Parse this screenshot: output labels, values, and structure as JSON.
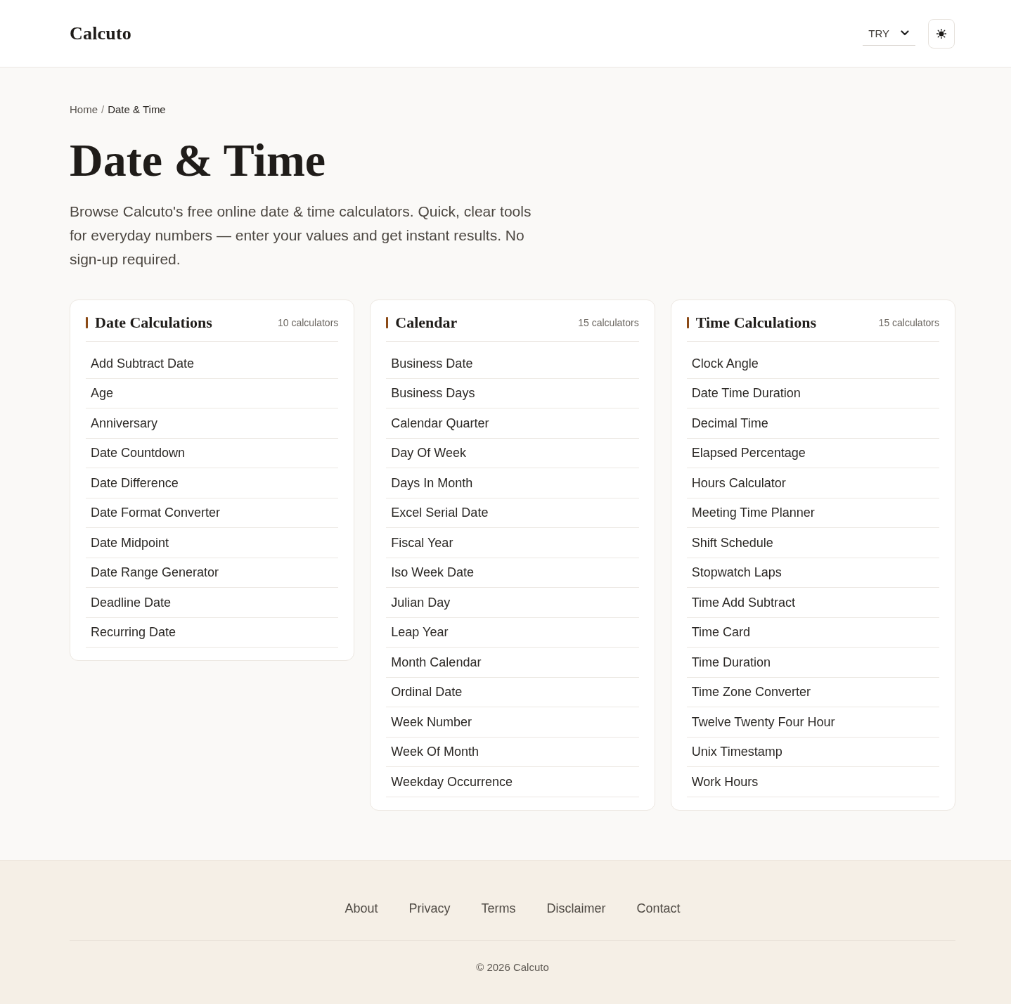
{
  "header": {
    "logo": "Calcuto",
    "currency": {
      "value": "TRY"
    }
  },
  "breadcrumb": {
    "separator": "/",
    "items": [
      {
        "label": "Home",
        "current": false
      },
      {
        "label": "Date & Time",
        "current": true
      }
    ]
  },
  "page": {
    "title": "Date & Time",
    "description": "Browse Calcuto's free online date & time calculators. Quick, clear tools for everyday numbers — enter your values and get instant results. No sign-up required."
  },
  "categories": [
    {
      "title": "Date Calculations",
      "count": "10 calculators",
      "items": [
        "Add Subtract Date",
        "Age",
        "Anniversary",
        "Date Countdown",
        "Date Difference",
        "Date Format Converter",
        "Date Midpoint",
        "Date Range Generator",
        "Deadline Date",
        "Recurring Date"
      ]
    },
    {
      "title": "Calendar",
      "count": "15 calculators",
      "items": [
        "Business Date",
        "Business Days",
        "Calendar Quarter",
        "Day Of Week",
        "Days In Month",
        "Excel Serial Date",
        "Fiscal Year",
        "Iso Week Date",
        "Julian Day",
        "Leap Year",
        "Month Calendar",
        "Ordinal Date",
        "Week Number",
        "Week Of Month",
        "Weekday Occurrence"
      ]
    },
    {
      "title": "Time Calculations",
      "count": "15 calculators",
      "items": [
        "Clock Angle",
        "Date Time Duration",
        "Decimal Time",
        "Elapsed Percentage",
        "Hours Calculator",
        "Meeting Time Planner",
        "Shift Schedule",
        "Stopwatch Laps",
        "Time Add Subtract",
        "Time Card",
        "Time Duration",
        "Time Zone Converter",
        "Twelve Twenty Four Hour",
        "Unix Timestamp",
        "Work Hours"
      ]
    }
  ],
  "footer": {
    "links": [
      "About",
      "Privacy",
      "Terms",
      "Disclaimer",
      "Contact"
    ],
    "copyright": "© 2026 Calcuto"
  }
}
